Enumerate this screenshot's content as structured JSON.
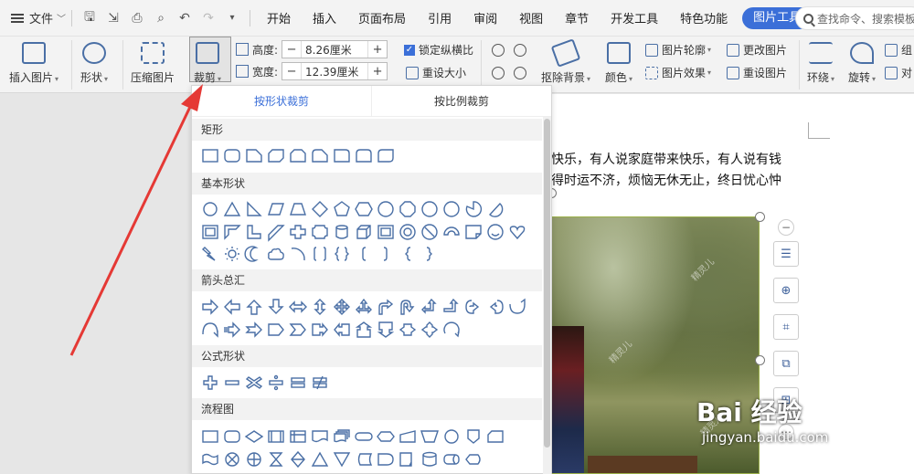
{
  "menubar": {
    "file_label": "文件",
    "tabs": [
      "开始",
      "插入",
      "页面布局",
      "引用",
      "审阅",
      "视图",
      "章节",
      "开发工具",
      "特色功能"
    ],
    "active_tab": "图片工具",
    "search_placeholder": "查找命令、搜索模板"
  },
  "ribbon": {
    "insert_picture": "插入图片",
    "shape": "形状",
    "compress_picture": "压缩图片",
    "crop": "裁剪",
    "height_label": "高度:",
    "height_value": "8.26厘米",
    "width_label": "宽度:",
    "width_value": "12.39厘米",
    "lock_ratio": "锁定纵横比",
    "reset_size": "重设大小",
    "remove_bg": "抠除背景",
    "color": "颜色",
    "picture_outline": "图片轮廓",
    "picture_effect": "图片效果",
    "change_picture": "更改图片",
    "reset_picture": "重设图片",
    "wrap": "环绕",
    "rotate": "旋转",
    "group_partial": "组",
    "align_partial": "对"
  },
  "crop_dropdown": {
    "tabs": [
      "按形状裁剪",
      "按比例裁剪"
    ],
    "active_tab_index": 0,
    "categories": [
      "矩形",
      "基本形状",
      "箭头总汇",
      "公式形状",
      "流程图"
    ]
  },
  "document": {
    "line1": "快乐，有人说家庭带来快乐，有人说有钱",
    "line2": "得时运不济，烦恼无休无止，终日忧心忡",
    "photo_watermark": "精灵儿"
  },
  "watermark": {
    "brand": "Bai 经验",
    "url": "jingyan.baidu.com"
  },
  "colors": {
    "accent": "#3b6fd8",
    "arrow": "#e53935",
    "icon": "#4a6fa5"
  }
}
